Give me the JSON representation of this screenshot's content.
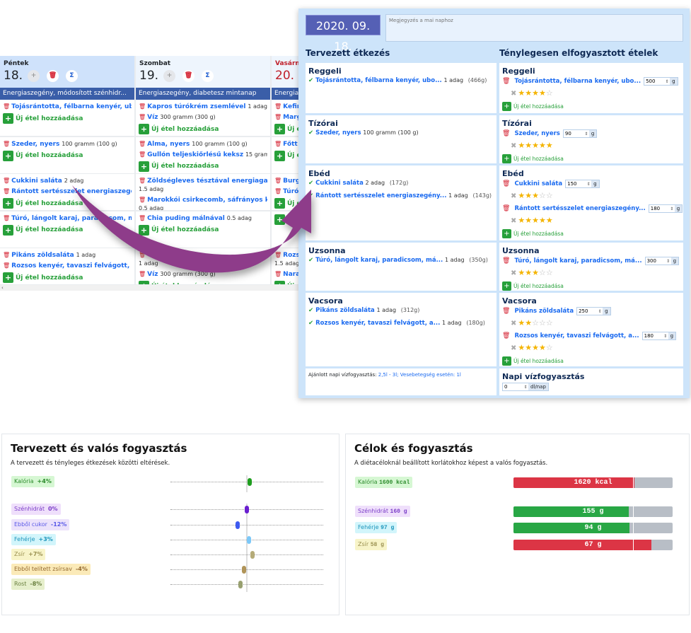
{
  "calendar": {
    "add_label": "Új étel hozzáadása",
    "scroll_left": "‹",
    "days": [
      {
        "name": "Péntek",
        "num": "18.",
        "plan": "Energiaszegény, módosított szénhidr...",
        "weekend": false,
        "selected": true,
        "meals": [
          [
            {
              "n": "Tojásrántotta, félbarna kenyér, ubo...",
              "q": "1 adag"
            }
          ],
          [
            {
              "n": "Szeder, nyers",
              "q": "100 gramm (100 g)"
            }
          ],
          [
            {
              "n": "Cukkini saláta",
              "q": "2 adag"
            },
            {
              "n": "Rántott sertésszelet energiaszegény...",
              "q": "1 adag"
            }
          ],
          [
            {
              "n": "Túró, lángolt karaj, paradicsom, má...",
              "q": "1 adag"
            }
          ],
          [
            {
              "n": "Pikáns zöldsaláta",
              "q": "1 adag"
            },
            {
              "n": "Rozsos kenyér, tavaszi felvágott, a...",
              "q": "1 adag"
            }
          ]
        ]
      },
      {
        "name": "Szombat",
        "num": "19.",
        "plan": "Energiaszegény, diabetesz mintanap",
        "weekend": false,
        "selected": false,
        "meals": [
          [
            {
              "n": "Kapros túrókrém zsemlével",
              "q": "1 adag"
            },
            {
              "n": "Víz",
              "q": "300 gramm (300 g)"
            }
          ],
          [
            {
              "n": "Alma, nyers",
              "q": "100 gramm (100 g)"
            },
            {
              "n": "Gullón teljeskiőrlésű keksz",
              "q": "15 gramm (15 g)"
            }
          ],
          [
            {
              "n": "Zöldségleves tésztával energiagazda...",
              "q": "1.5 adag",
              "br": true
            },
            {
              "n": "Marokkói csirkecomb, sáfrányos köle...",
              "q": "0.5 adag",
              "br": true
            }
          ],
          [
            {
              "n": "Chia puding málnával",
              "q": "0.5 adag"
            }
          ],
          [
            {
              "n": "",
              "q": "1 adag",
              "br": true
            },
            {
              "n": "Víz",
              "q": "300 gramm (300 g)"
            }
          ]
        ]
      },
      {
        "name": "Vasárnap",
        "num": "20.",
        "plan": "Energiasz",
        "weekend": true,
        "selected": false,
        "meals": [
          [
            {
              "n": "Kefir p",
              "q": ""
            },
            {
              "n": "Marga",
              "q": ""
            }
          ],
          [
            {
              "n": "Főtt to",
              "q": ""
            }
          ],
          [
            {
              "n": "Burgon",
              "q": ""
            },
            {
              "n": "Túrógo",
              "q": ""
            }
          ],
          [],
          [
            {
              "n": "Rozske",
              "q": "1.5 adag",
              "br": true
            },
            {
              "n": "Naranc",
              "q": ""
            }
          ]
        ]
      }
    ]
  },
  "day_panel": {
    "date": "2020. 09. 18.",
    "note_placeholder": "Megjegyzés a mai naphoz",
    "planned_title": "Tervezett étkezés",
    "actual_title": "Ténylegesen elfogyasztott ételek",
    "add_label": "Új étel hozzáadása",
    "unit": "g",
    "meals": [
      {
        "title": "Reggeli",
        "planned": [
          {
            "n": "Tojásrántotta, félbarna kenyér, ubo...",
            "q": "1 adag",
            "g": "(466g)"
          }
        ],
        "actual": [
          {
            "n": "Tojásrántotta, félbarna kenyér, ubo...",
            "amount": "500",
            "rating": 4
          }
        ]
      },
      {
        "title": "Tízórai",
        "planned": [
          {
            "n": "Szeder, nyers",
            "q": "100 gramm (100 g)",
            "g": ""
          }
        ],
        "actual": [
          {
            "n": "Szeder, nyers",
            "amount": "90",
            "rating": 5
          }
        ]
      },
      {
        "title": "Ebéd",
        "planned": [
          {
            "n": "Cukkini saláta",
            "q": "2 adag",
            "g": "(172g)"
          },
          {
            "n": "Rántott sertésszelet energiaszegény...",
            "q": "1 adag",
            "g": "(143g)"
          }
        ],
        "actual": [
          {
            "n": "Cukkini saláta",
            "amount": "150",
            "rating": 3
          },
          {
            "n": "Rántott sertésszelet energiaszegény...",
            "amount": "180",
            "rating": 5
          }
        ]
      },
      {
        "title": "Uzsonna",
        "planned": [
          {
            "n": "Túró, lángolt karaj, paradicsom, má...",
            "q": "1 adag",
            "g": "(350g)"
          }
        ],
        "actual": [
          {
            "n": "Túró, lángolt karaj, paradicsom, má...",
            "amount": "300",
            "rating": 3
          }
        ]
      },
      {
        "title": "Vacsora",
        "planned": [
          {
            "n": "Pikáns zöldsaláta",
            "q": "1 adag",
            "g": "(312g)"
          },
          {
            "n": "Rozsos kenyér, tavaszi felvágott, a...",
            "q": "1 adag",
            "g": "(180g)"
          }
        ],
        "actual": [
          {
            "n": "Pikáns zöldsaláta",
            "amount": "250",
            "rating": 2
          },
          {
            "n": "Rozsos kenyér, tavaszi felvágott, a...",
            "amount": "180",
            "rating": 4
          }
        ]
      }
    ],
    "water": {
      "recommended_label": "Ajánlott napi vízfogyasztás:",
      "recommended_value": "2,5l - 3l; Vesebetegség esetén: 1l",
      "title": "Napi vízfogyasztás",
      "value": "0",
      "unit": "dl/nap"
    }
  },
  "chart_data": [
    {
      "type": "scatter",
      "title": "Tervezett és valós fogyasztás",
      "subtitle": "A tervezett és tényleges étkezések közötti eltérések.",
      "xlim": [
        -100,
        100
      ],
      "grid": false,
      "items": [
        {
          "label": "Kalória",
          "display": "+4%",
          "value": 4,
          "bg": "#d6f7d3",
          "fg": "#2a8a2a",
          "color": "#1f9e1f"
        },
        {
          "label": "Szénhidrát",
          "display": "0%",
          "value": 0,
          "bg": "#efdffb",
          "fg": "#7a3cc8",
          "color": "#6a1fd0"
        },
        {
          "label": "Ebből cukor",
          "display": "-12%",
          "value": -12,
          "bg": "#ece2fb",
          "fg": "#5a5ae8",
          "color": "#3d5af0"
        },
        {
          "label": "Fehérje",
          "display": "+3%",
          "value": 3,
          "bg": "#d2f5fb",
          "fg": "#1a94bb",
          "color": "#7cc8f8"
        },
        {
          "label": "Zsír",
          "display": "+7%",
          "value": 7,
          "bg": "#f8f4c8",
          "fg": "#9a9050",
          "color": "#b5ab78"
        },
        {
          "label": "Ebből telített zsírsav",
          "display": "-4%",
          "value": -4,
          "bg": "#fbeab8",
          "fg": "#946a30",
          "color": "#b09458"
        },
        {
          "label": "Rost",
          "display": "-8%",
          "value": -8,
          "bg": "#e6efcc",
          "fg": "#6a8040",
          "color": "#98a070"
        }
      ]
    },
    {
      "type": "bar",
      "title": "Célok és fogyasztás",
      "subtitle": "A diétacéloknál beállított korlátokhoz képest a valós fogyasztás.",
      "items": [
        {
          "label": "Kalória",
          "target": 1600,
          "target_display": "1600 kcal",
          "actual": 1620,
          "actual_display": "1620 kcal",
          "color": "#dc3545",
          "bg": "#d6f7d3",
          "fg": "#2a8a2a"
        },
        {
          "label": "Szénhidrát",
          "target": 160,
          "target_display": "160 g",
          "actual": 155,
          "actual_display": "155 g",
          "color": "#28a745",
          "bg": "#efdffb",
          "fg": "#7a3cc8"
        },
        {
          "label": "Fehérje",
          "target": 97,
          "target_display": "97 g",
          "actual": 94,
          "actual_display": "94 g",
          "color": "#28a745",
          "bg": "#d2f5fb",
          "fg": "#1a94bb"
        },
        {
          "label": "Zsír",
          "target": 58,
          "target_display": "58 g",
          "actual": 67,
          "actual_display": "67 g",
          "color": "#dc3545",
          "bg": "#f8f4c8",
          "fg": "#9a9050"
        }
      ]
    }
  ]
}
